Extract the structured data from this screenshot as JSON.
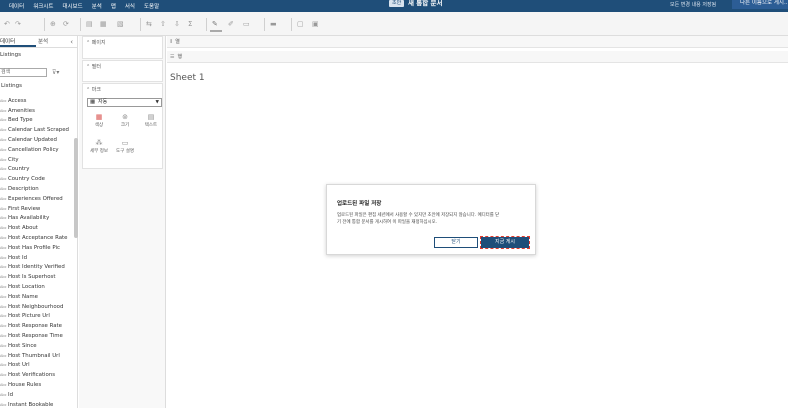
{
  "menu": [
    "데이터",
    "워크시트",
    "대시보드",
    "분석",
    "맵",
    "서식",
    "도움말"
  ],
  "header": {
    "status_badge": "초안",
    "doc_title": "새 통합 문서",
    "unsaved_text": "모든 변경 내용 저장됨",
    "save_as_label": "다른 이름으로 게시..."
  },
  "left_panel": {
    "tab_data": "데이터",
    "tab_analysis": "분석",
    "collapse": "‹",
    "datasource": "Listings",
    "search_placeholder": "검색",
    "table_header": "Listings",
    "fields": [
      "Access",
      "Amenities",
      "Bed Type",
      "Calendar Last Scraped",
      "Calendar Updated",
      "Cancellation Policy",
      "City",
      "Country",
      "Country Code",
      "Description",
      "Experiences Offered",
      "First Review",
      "Has Availability",
      "Host About",
      "Host Acceptance Rate",
      "Host Has Profile Pic",
      "Host Id",
      "Host Identity Verified",
      "Host Is Superhost",
      "Host Location",
      "Host Name",
      "Host Neighbourhood",
      "Host Picture Url",
      "Host Response Rate",
      "Host Response Time",
      "Host Since",
      "Host Thumbnail Url",
      "Host Url",
      "Host Verifications",
      "House Rules",
      "Id",
      "Instant Bookable"
    ]
  },
  "mid_panel": {
    "pages_label": "페이지",
    "filters_label": "필터",
    "marks_label": "마크",
    "marks_type": "자동",
    "mark_buttons": [
      "색상",
      "크기",
      "텍스트",
      "세부 정보",
      "도구 설명"
    ]
  },
  "canvas": {
    "columns_label": "열",
    "rows_label": "행",
    "sheet_title": "Sheet 1"
  },
  "dialog": {
    "title": "업로드된 파일 저장",
    "body": "업로드된 파일은 편집 세션에서 사용할 수 있지만 초안에 저장되지 않습니다. 예디터를 닫\n기 전에 통합 문서를 게시하여 이 파일을 재정하십시오.",
    "close_label": "닫기",
    "publish_label": "지금 게시"
  },
  "colors": {
    "brand": "#1f4e79",
    "highlight": "#e23b2e"
  }
}
